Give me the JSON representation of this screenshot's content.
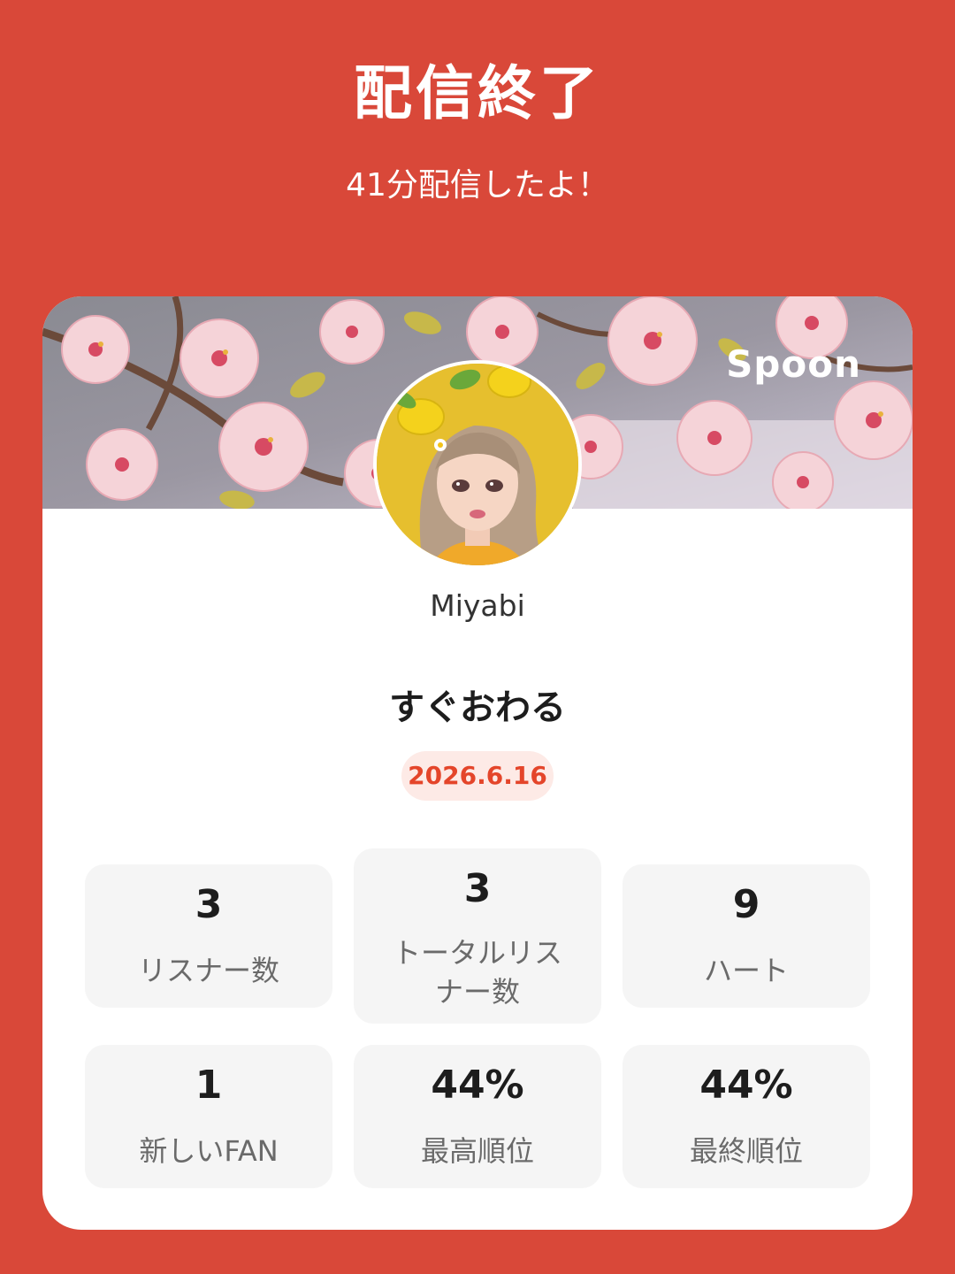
{
  "header": {
    "title": "配信終了",
    "subtitle": "41分配信したよ！"
  },
  "card": {
    "brand": "Spoon",
    "username": "Miyabi",
    "stream_title": "すぐおわる",
    "date": "2026.6.16",
    "stats": [
      {
        "value": "3",
        "label": "リスナー数"
      },
      {
        "value": "3",
        "label": "トータルリスナー数"
      },
      {
        "value": "9",
        "label": "ハート"
      },
      {
        "value": "1",
        "label": "新しいFAN"
      },
      {
        "value": "44%",
        "label": "最高順位"
      },
      {
        "value": "44%",
        "label": "最終順位"
      }
    ]
  },
  "colors": {
    "background": "#d94839",
    "card": "#ffffff",
    "accent": "#e4452a",
    "badge_bg": "#fdeae6",
    "stat_bg": "#f5f5f5"
  },
  "icons": {
    "banner": "cherry-blossom-banner-image",
    "avatar": "user-avatar-image",
    "brand": "spoon-logo"
  }
}
